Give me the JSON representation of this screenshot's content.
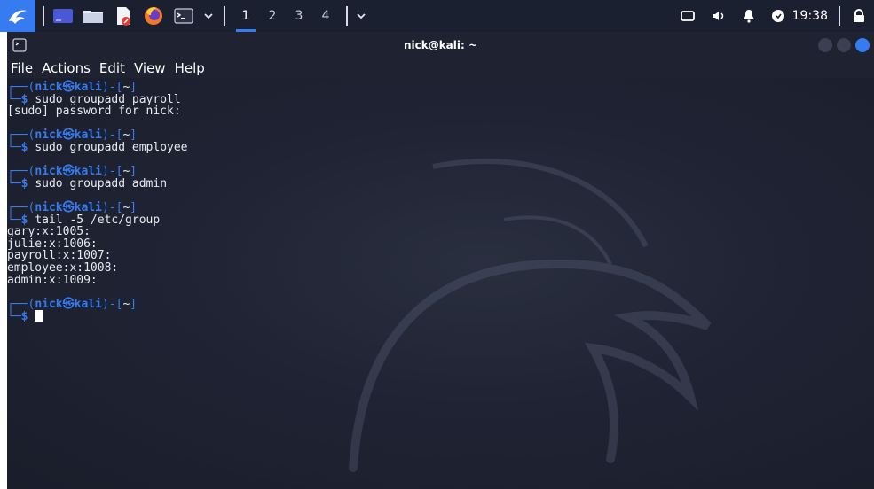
{
  "panel": {
    "workspaces": [
      "1",
      "2",
      "3",
      "4"
    ],
    "active_workspace": "1",
    "clock": "19:38",
    "accent_color": "#367bf0",
    "icons": [
      "kali-menu-icon",
      "show-desktop-icon",
      "file-manager-icon",
      "text-editor-icon",
      "firefox-icon",
      "terminal-icon",
      "network-icon",
      "volume-icon",
      "notification-bell-icon",
      "power-icon",
      "lock-icon"
    ]
  },
  "window": {
    "title": "nick@kali: ~",
    "menu": [
      "File",
      "Actions",
      "Edit",
      "View",
      "Help"
    ]
  },
  "terminal": {
    "prompt_user": "nick",
    "prompt_host": "kali",
    "prompt_dir": "~",
    "blocks": [
      {
        "command": "sudo groupadd payroll",
        "output": [
          "[sudo] password for nick:"
        ]
      },
      {
        "command": "sudo groupadd employee",
        "output": []
      },
      {
        "command": "sudo groupadd admin",
        "output": []
      },
      {
        "command": "tail -5 /etc/group",
        "output": [
          "gary:x:1005:",
          "julie:x:1006:",
          "payroll:x:1007:",
          "employee:x:1008:",
          "admin:x:1009:"
        ]
      }
    ],
    "final_prompt": true
  }
}
